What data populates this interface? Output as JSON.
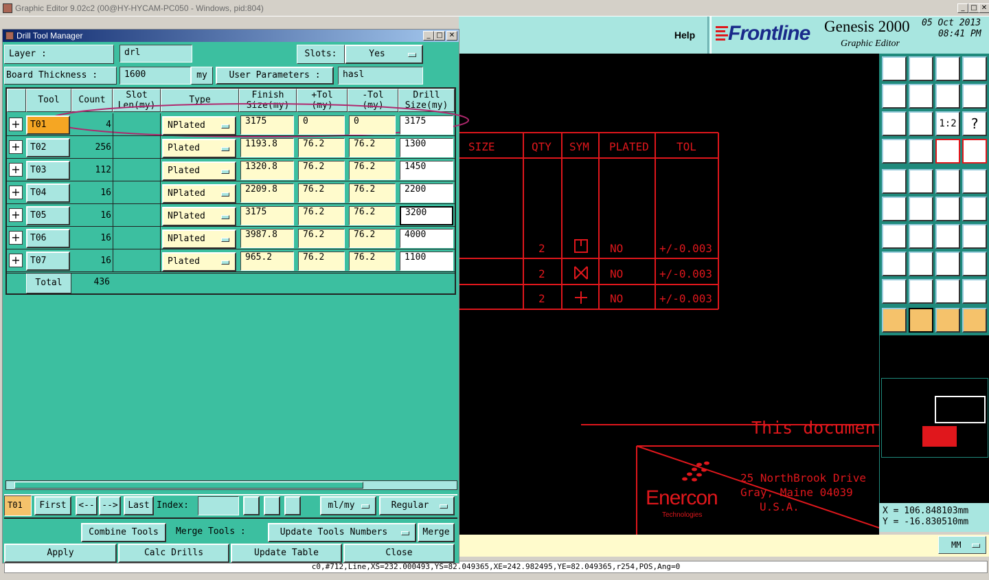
{
  "app_title": "Graphic Editor 9.02c2 (00@HY-HYCAM-PC050 - Windows, pid:804)",
  "window_buttons": [
    "_",
    "□",
    "✕"
  ],
  "header": {
    "help": "Help",
    "brand": "Frontline",
    "product": "Genesis 2000",
    "subtitle": "Graphic Editor",
    "date": "05 Oct 2013",
    "time": "08:41 PM"
  },
  "dialog": {
    "title": "Drill Tool Manager",
    "layer_label": "Layer :",
    "layer_value": "drl",
    "slots_label": "Slots:",
    "slots_value": "Yes",
    "board_thickness_label": "Board Thickness :",
    "board_thickness_value": "1600",
    "board_thickness_unit": "my",
    "user_params_label": "User Parameters :",
    "user_params_value": "hasl",
    "columns": [
      "Tool",
      "Count",
      "Slot\nLen(my)",
      "Type",
      "Finish\nSize(my)",
      "+Tol\n(my)",
      "-Tol\n(my)",
      "Drill\nSize(my)"
    ],
    "rows": [
      {
        "tool": "T01",
        "count": "4",
        "slot": "",
        "type": "NPlated",
        "finish": "3175",
        "ptol": "0",
        "mtol": "0",
        "drill": "3175"
      },
      {
        "tool": "T02",
        "count": "256",
        "slot": "",
        "type": "Plated",
        "finish": "1193.8",
        "ptol": "76.2",
        "mtol": "76.2",
        "drill": "1300"
      },
      {
        "tool": "T03",
        "count": "112",
        "slot": "",
        "type": "Plated",
        "finish": "1320.8",
        "ptol": "76.2",
        "mtol": "76.2",
        "drill": "1450"
      },
      {
        "tool": "T04",
        "count": "16",
        "slot": "",
        "type": "NPlated",
        "finish": "2209.8",
        "ptol": "76.2",
        "mtol": "76.2",
        "drill": "2200"
      },
      {
        "tool": "T05",
        "count": "16",
        "slot": "",
        "type": "NPlated",
        "finish": "3175",
        "ptol": "76.2",
        "mtol": "76.2",
        "drill": "3200"
      },
      {
        "tool": "T06",
        "count": "16",
        "slot": "",
        "type": "NPlated",
        "finish": "3987.8",
        "ptol": "76.2",
        "mtol": "76.2",
        "drill": "4000"
      },
      {
        "tool": "T07",
        "count": "16",
        "slot": "",
        "type": "Plated",
        "finish": "965.2",
        "ptol": "76.2",
        "mtol": "76.2",
        "drill": "1100"
      }
    ],
    "total_label": "Total",
    "total_value": "436",
    "nav": {
      "current": "T01",
      "first": "First",
      "prev": "<--",
      "next": "-->",
      "last": "Last",
      "index_label": "Index:",
      "unit": "ml/my",
      "mode": "Regular"
    },
    "actions": {
      "combine": "Combine Tools",
      "merge_label": "Merge Tools :",
      "update_numbers": "Update Tools Numbers",
      "merge": "Merge",
      "apply": "Apply",
      "calc": "Calc Drills",
      "update_table": "Update Table",
      "close": "Close"
    }
  },
  "canvas": {
    "table_headers": [
      "SIZE",
      "QTY",
      "SYM",
      "PLATED",
      "TOL"
    ],
    "table_rows": [
      {
        "qty": "2",
        "plated": "NO",
        "tol": "+/-0.003"
      },
      {
        "qty": "2",
        "plated": "NO",
        "tol": "+/-0.003"
      },
      {
        "qty": "2",
        "plated": "NO",
        "tol": "+/-0.003"
      }
    ],
    "doc_text": "This document",
    "company": "Enercon",
    "company_sub": "Technologies",
    "address1": "25 NorthBrook Drive",
    "address2": "Gray, Maine 04039",
    "address3": "U.S.A."
  },
  "coords": {
    "x": "X  =  106.848103mm",
    "y": "Y  = -16.830510mm"
  },
  "units_button": "MM",
  "status_line": "c0,#712,Line,XS=232.000493,YS=82.049365,XE=242.982495,YE=82.049365,r254,POS,Ang=0",
  "colors": {
    "teal": "#3cbfa0",
    "panel": "#a8e6e0",
    "cream": "#fffbcc",
    "red": "#e0171c",
    "highlight": "#f5a623"
  }
}
